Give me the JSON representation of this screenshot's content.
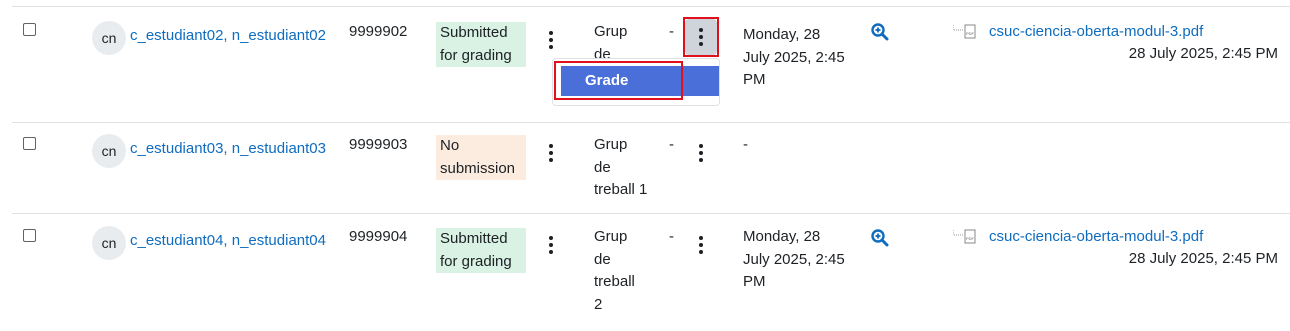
{
  "accent_color": "#0f6cbf",
  "rows": [
    {
      "avatar": "cn",
      "name": "c_estudiant02, n_estudiant02",
      "id": "9999902",
      "status_lines": [
        "Submitted",
        "for grading"
      ],
      "status_color": "#d9f2e3",
      "group_lines": [
        "Grup",
        "de"
      ],
      "group_dash": "-",
      "date_lines": [
        "Monday, 28",
        "July 2025, 2:45",
        "PM"
      ],
      "file_name": "csuc-ciencia-oberta-modul-3.pdf",
      "file_date": "28 July 2025, 2:45 PM"
    },
    {
      "avatar": "cn",
      "name": "c_estudiant03, n_estudiant03",
      "id": "9999903",
      "status_lines": [
        "No",
        "submission"
      ],
      "status_color": "#fcecdf",
      "group_lines": [
        "Grup",
        "de",
        "treball 1"
      ],
      "group_dash": "-",
      "date_lines": [
        "-"
      ]
    },
    {
      "avatar": "cn",
      "name": "c_estudiant04, n_estudiant04",
      "id": "9999904",
      "status_lines": [
        "Submitted",
        "for grading"
      ],
      "status_color": "#d9f2e3",
      "group_lines": [
        "Grup",
        "de",
        "treball",
        "2"
      ],
      "group_dash": "-",
      "date_lines": [
        "Monday, 28",
        "July 2025, 2:45",
        "PM"
      ],
      "file_name": "csuc-ciencia-oberta-modul-3.pdf",
      "file_date": "28 July 2025, 2:45 PM"
    }
  ],
  "menu": {
    "grade_label": "Grade"
  },
  "icons": {
    "zoom": "search-plus-icon",
    "file": "pdf-file-icon",
    "kebab": "kebab-icon"
  }
}
